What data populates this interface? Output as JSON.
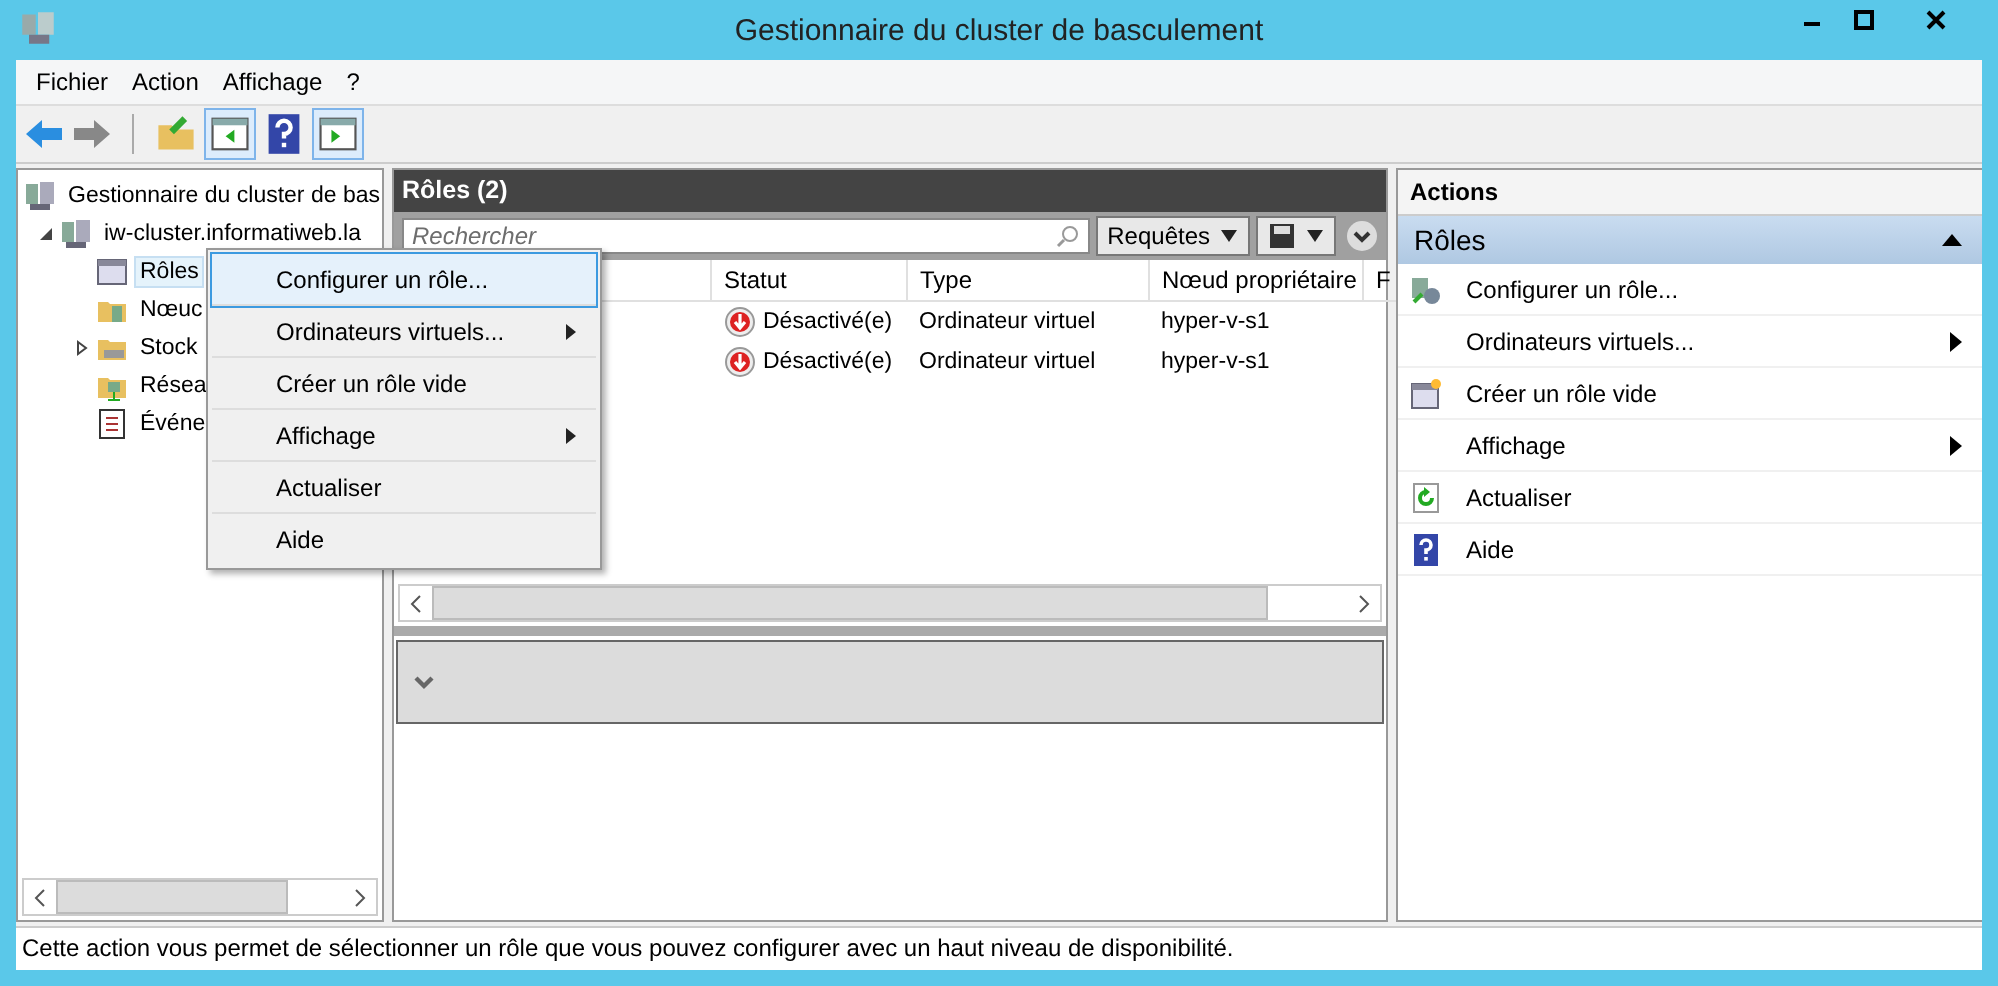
{
  "window": {
    "title": "Gestionnaire du cluster de basculement"
  },
  "menu_bar": [
    "Fichier",
    "Action",
    "Affichage",
    "?"
  ],
  "toolbar": [
    {
      "kind": "back",
      "disabled": false
    },
    {
      "kind": "forward",
      "disabled": true
    },
    {
      "kind": "separator"
    },
    {
      "kind": "up"
    },
    {
      "kind": "tree-toggle",
      "pressed": true
    },
    {
      "kind": "help"
    },
    {
      "kind": "actions-toggle",
      "pressed": true
    }
  ],
  "tree": [
    {
      "label": "Gestionnaire du cluster de bas",
      "kind": "cluster",
      "children": [
        {
          "label": "iw-cluster.informatiweb.la",
          "kind": "cluster",
          "expanded": true,
          "children": [
            {
              "label": "Rôles",
              "kind": "roles",
              "selected": true
            },
            {
              "label": "Nœuc",
              "kind": "nodes",
              "selected": false
            },
            {
              "label": "Stock",
              "kind": "storage",
              "selected": false,
              "expanded": false
            },
            {
              "label": "Résea",
              "kind": "network",
              "selected": false
            },
            {
              "label": "Événe",
              "kind": "events",
              "selected": false
            }
          ]
        }
      ]
    }
  ],
  "context_menu": [
    {
      "label": "Configurer un rôle...",
      "selected": true,
      "submenu": false
    },
    {
      "label": "Ordinateurs virtuels...",
      "selected": false,
      "submenu": true
    },
    {
      "label": "Créer un rôle vide",
      "selected": false,
      "submenu": false
    },
    {
      "label": "Affichage",
      "selected": false,
      "submenu": true
    },
    {
      "label": "Actualiser",
      "selected": false,
      "submenu": false
    },
    {
      "label": "Aide",
      "selected": false,
      "submenu": false
    }
  ],
  "roles_panel": {
    "title": "Rôles (2)",
    "search": {
      "placeholder": "Rechercher"
    },
    "queries_button": "Requêtes",
    "table": {
      "columns": [
        "Statut",
        "Type",
        "Nœud propriétaire",
        "F"
      ],
      "rows": [
        {
          "status": "Désactivé(e)",
          "kind": "off",
          "type": "Ordinateur virtuel",
          "owner": "hyper-v-s1"
        },
        {
          "status": "Désactivé(e)",
          "kind": "off",
          "type": "Ordinateur virtuel",
          "owner": "hyper-v-s1"
        }
      ]
    }
  },
  "actions": {
    "title": "Actions",
    "section": {
      "title": "Rôles",
      "expanded": true
    },
    "items": [
      {
        "label": "Configurer un rôle...",
        "kind": "configure",
        "submenu": false
      },
      {
        "label": "Ordinateurs virtuels...",
        "kind": "plain",
        "submenu": true
      },
      {
        "label": "Créer un rôle vide",
        "kind": "new-role",
        "submenu": false
      },
      {
        "label": "Affichage",
        "kind": "plain",
        "submenu": true
      },
      {
        "label": "Actualiser",
        "kind": "refresh",
        "submenu": false
      },
      {
        "label": "Aide",
        "kind": "help",
        "submenu": false
      }
    ]
  },
  "status_bar": "Cette action vous permet de sélectionner un rôle que vous pouvez configurer avec un haut niveau de disponibilité."
}
